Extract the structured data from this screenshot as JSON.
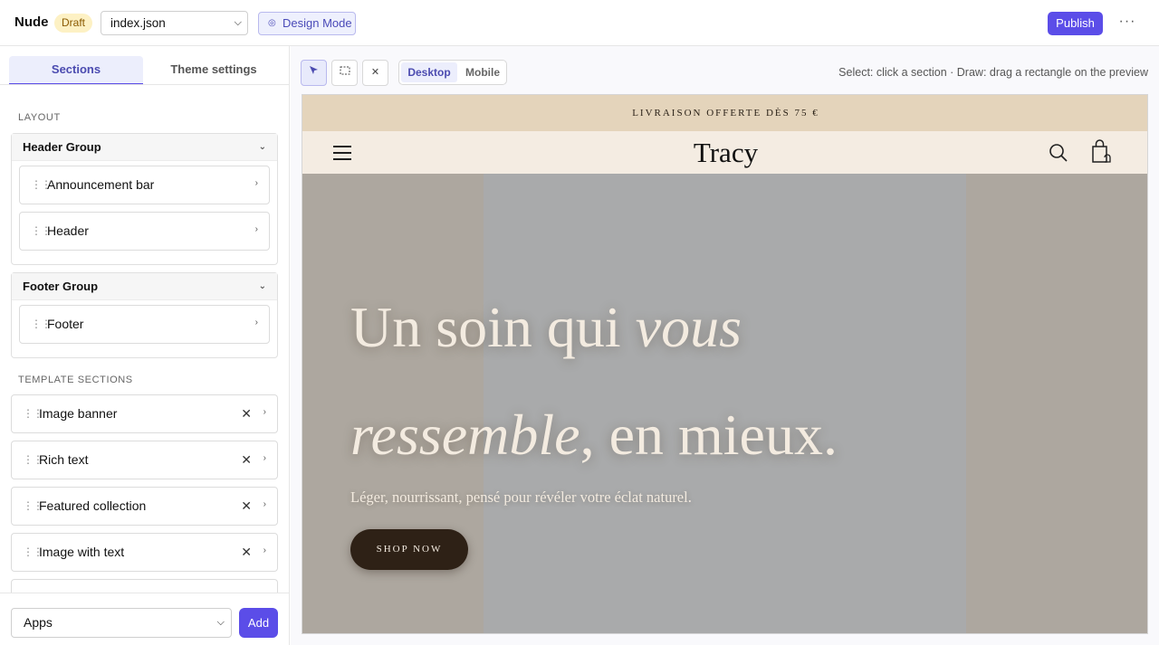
{
  "topbar": {
    "brand": "Nude",
    "draft_badge": "Draft",
    "file_select": "index.json",
    "design_mode": "Design Mode",
    "publish": "Publish",
    "more": "···"
  },
  "sidebar": {
    "tabs": [
      "Sections",
      "Theme settings"
    ],
    "layout_label": "LAYOUT",
    "header_group": {
      "title": "Header Group",
      "items": [
        "Announcement bar",
        "Header"
      ]
    },
    "footer_group": {
      "title": "Footer Group",
      "items": [
        "Footer"
      ]
    },
    "template_label": "TEMPLATE SECTIONS",
    "template_sections": [
      "Image banner",
      "Rich text",
      "Featured collection",
      "Image with text"
    ],
    "apps_select": "Apps",
    "add": "Add"
  },
  "toolbar": {
    "viewport_desktop": "Desktop",
    "viewport_mobile": "Mobile",
    "hint": "Select: click a section · Draw: drag a rectangle on the preview"
  },
  "preview": {
    "announcement": "LIVRAISON OFFERTE DÈS 75 €",
    "logo": "Tracy",
    "hero_line1_plain": "Un soin qui ",
    "hero_line1_italic": "vous",
    "hero_line2_italic": "ressemble",
    "hero_line2_plain": ", en mieux.",
    "hero_sub": "Léger, nourrissant, pensé pour révéler votre éclat naturel.",
    "cta": "SHOP NOW"
  },
  "colors": {
    "accent": "#5b4de8",
    "announcement_bg": "#e4d4bb",
    "header_bg": "#f4ece2",
    "cta_bg": "#2e2116"
  }
}
